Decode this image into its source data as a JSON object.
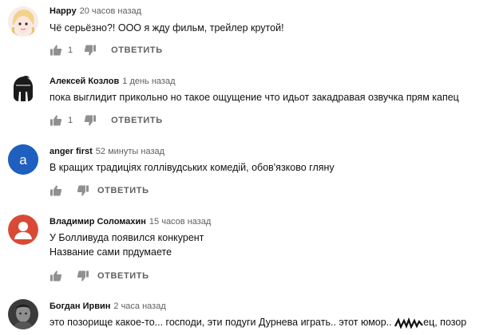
{
  "comments": [
    {
      "author": "Happy",
      "time": "20 часов назад",
      "lines": [
        "Чё серьёзно?! ООО  я жду фильм, трейлер крутой!"
      ],
      "likes": "1",
      "reply_label": "ОТВЕТИТЬ",
      "avatar_icon": "cartoon-girl-avatar"
    },
    {
      "author": "Алексей Козлов",
      "time": "1 день назад",
      "lines": [
        "пока выглидит прикольно но такое ощущение что идьот закадравая озвучка прям капец"
      ],
      "likes": "1",
      "reply_label": "ОТВЕТИТЬ",
      "avatar_icon": "spartan-helmet-avatar"
    },
    {
      "author": "anger first",
      "time": "52 минуты назад",
      "lines": [
        "В кращих традиціях голлівудських комедій, обов'язково гляну"
      ],
      "likes": "",
      "reply_label": "ОТВЕТИТЬ",
      "avatar_letter": "a",
      "avatar_color": "#1e5fbf"
    },
    {
      "author": "Владимир Соломахин",
      "time": "15 часов назад",
      "lines": [
        "У Болливуда появился конкурент",
        "Название сами прдумаете"
      ],
      "likes": "",
      "reply_label": "ОТВЕТИТЬ",
      "avatar_icon": "default-user-avatar",
      "avatar_color": "#d84a36"
    },
    {
      "author": "Богдан Ирвин",
      "time": "2 часа назад",
      "lines": [
        "это позорище какое-то... господи, эти подуги Дурнева играть.. этот юмор..",
        "ец, позор"
      ],
      "likes": "",
      "reply_label": "ОТВЕТИТЬ",
      "avatar_icon": "photo-avatar"
    }
  ],
  "colors": {
    "meta_gray": "#606060",
    "icon_gray": "#909090"
  }
}
